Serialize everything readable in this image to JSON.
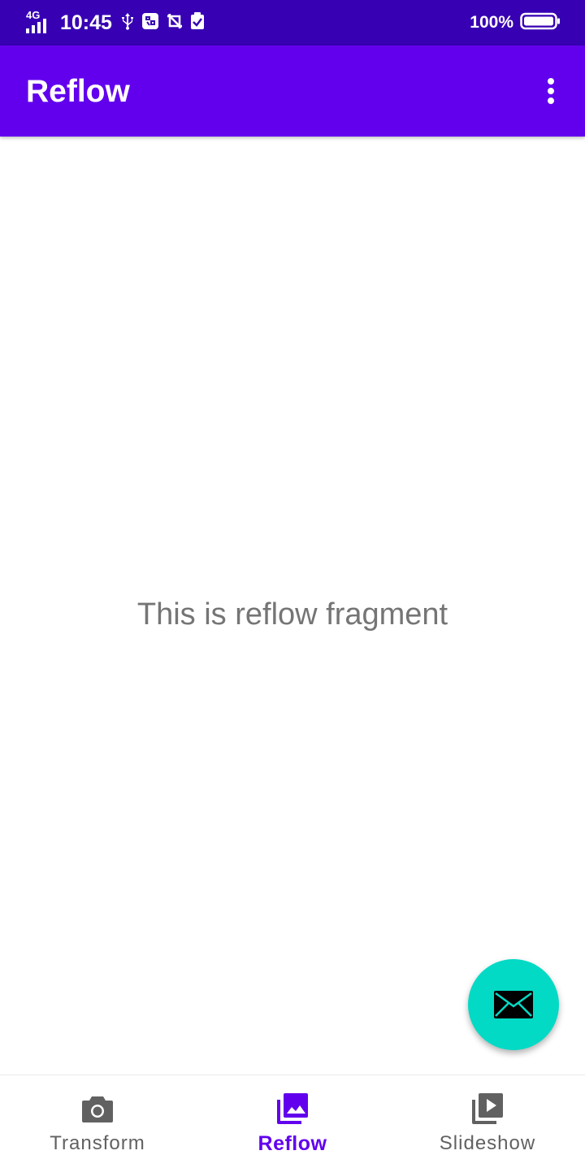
{
  "status_bar": {
    "network": "4G",
    "time": "10:45",
    "battery": "100%"
  },
  "app_bar": {
    "title": "Reflow"
  },
  "content": {
    "text": "This is reflow fragment"
  },
  "bottom_nav": {
    "items": [
      {
        "label": "Transform",
        "icon": "camera-icon",
        "active": false
      },
      {
        "label": "Reflow",
        "icon": "photo-library-icon",
        "active": true
      },
      {
        "label": "Slideshow",
        "icon": "slideshow-icon",
        "active": false
      }
    ]
  },
  "fab": {
    "icon": "email-icon"
  },
  "colors": {
    "status_bar": "#3700B3",
    "app_bar": "#6200EE",
    "accent": "#03DAC5",
    "active_nav": "#6200EE",
    "inactive_nav": "#616161"
  }
}
